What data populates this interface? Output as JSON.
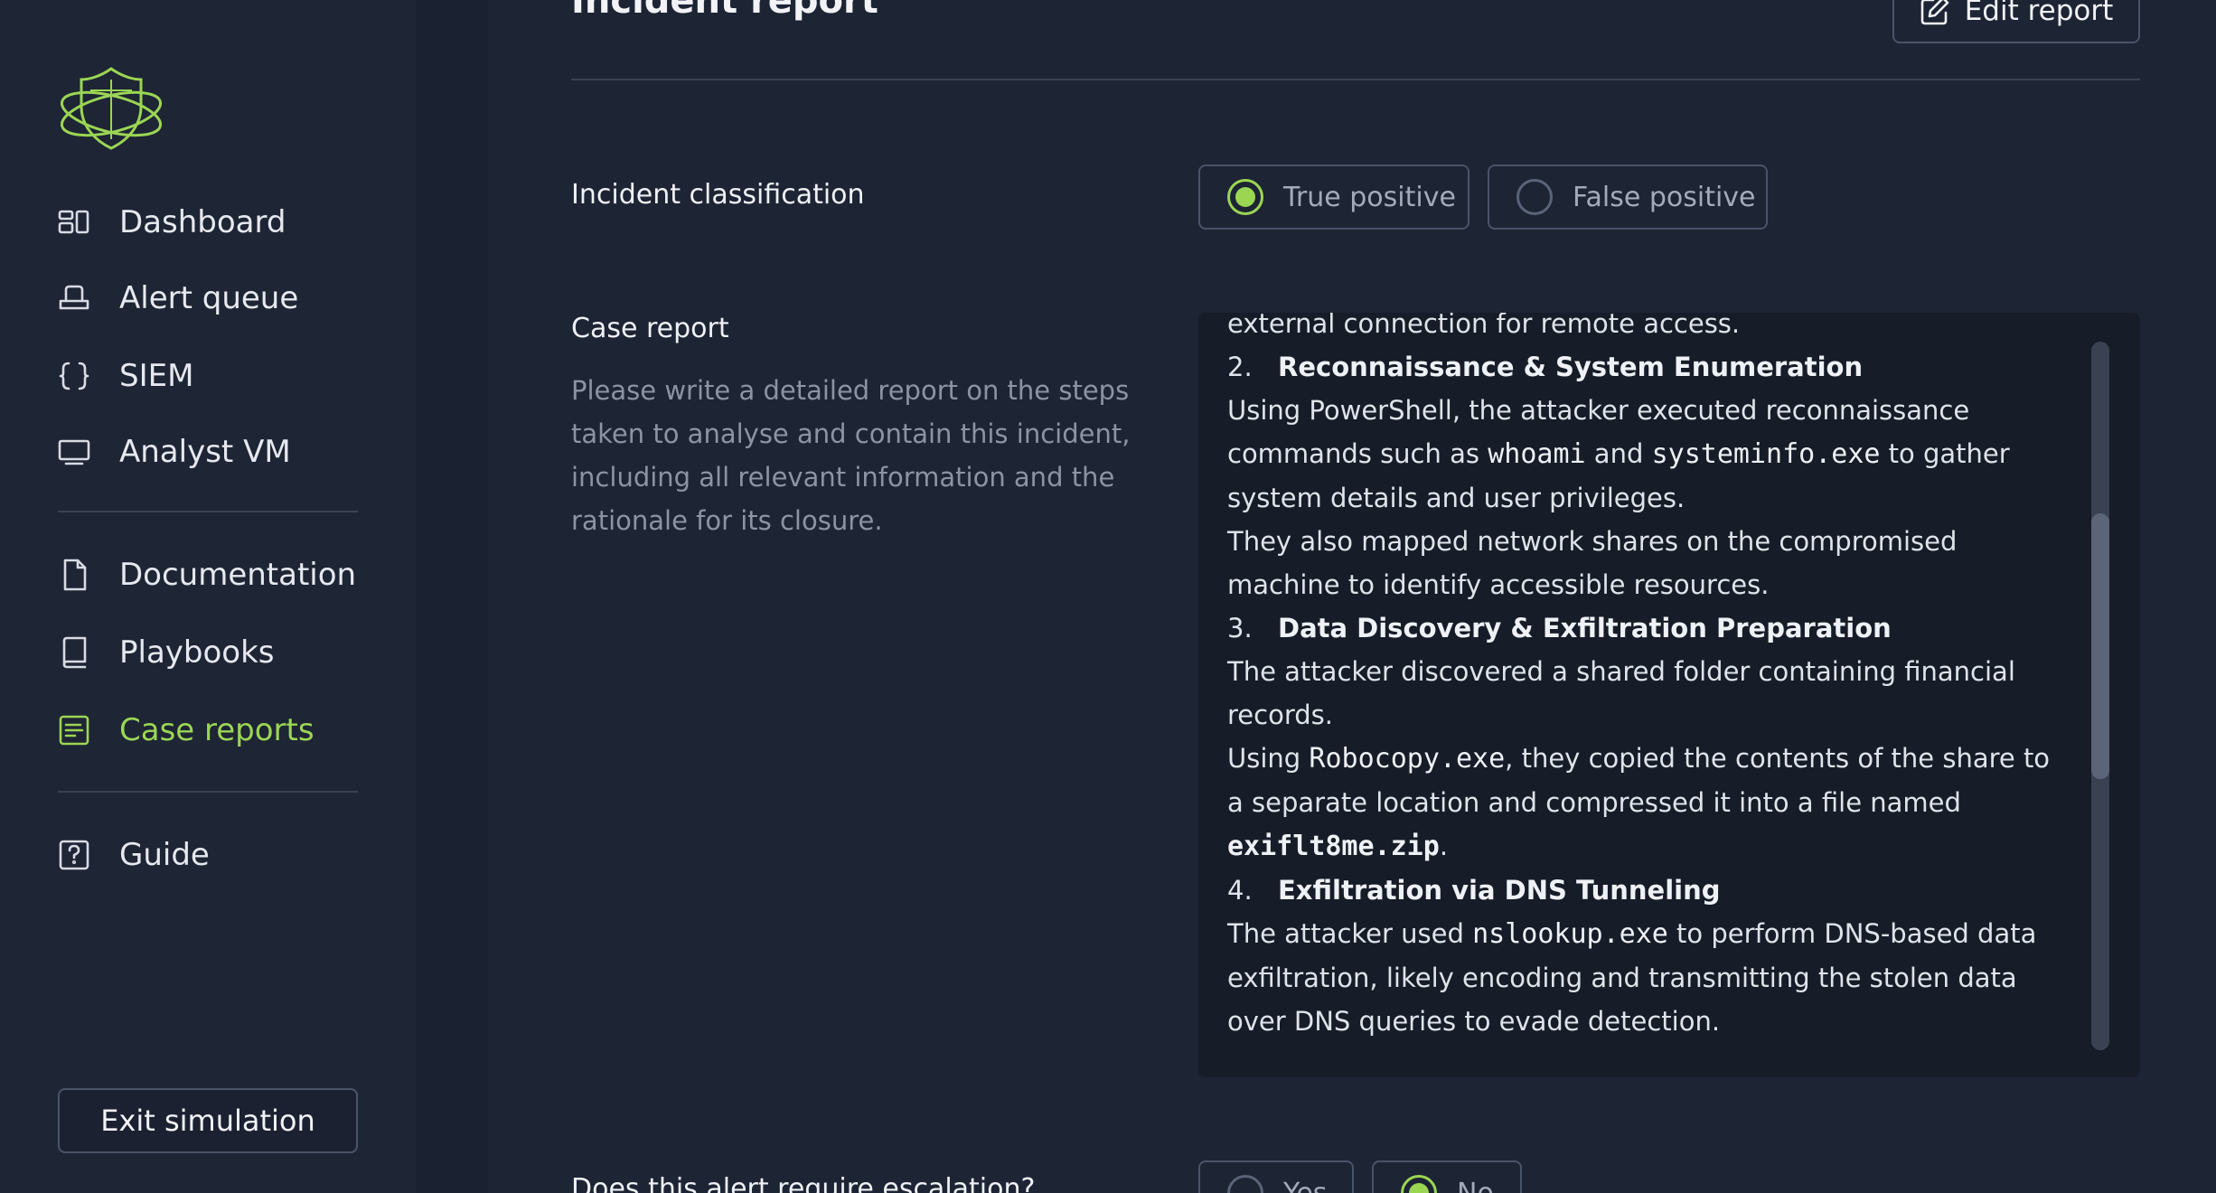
{
  "sidebar": {
    "nav": [
      {
        "label": "Dashboard",
        "icon": "dashboard-icon"
      },
      {
        "label": "Alert queue",
        "icon": "alert-queue-icon"
      },
      {
        "label": "SIEM",
        "icon": "braces-icon"
      },
      {
        "label": "Analyst VM",
        "icon": "monitor-icon"
      }
    ],
    "docs": [
      {
        "label": "Documentation",
        "icon": "file-icon"
      },
      {
        "label": "Playbooks",
        "icon": "book-icon"
      },
      {
        "label": "Case reports",
        "icon": "report-icon",
        "active": true
      }
    ],
    "guide": {
      "label": "Guide",
      "icon": "help-icon"
    },
    "exit_label": "Exit simulation"
  },
  "colors": {
    "accent": "#9bd653",
    "background": "#1d2434"
  },
  "main": {
    "title": "Incident report",
    "edit_label": "Edit report",
    "classification": {
      "label": "Incident classification",
      "options": [
        "True positive",
        "False positive"
      ],
      "selected": "True positive"
    },
    "case_report": {
      "label": "Case report",
      "hint": "Please write a detailed report on the steps taken to analyse and contain this incident, including all relevant information and the rationale for its closure.",
      "partial_line": "external connection for remote access.",
      "sections": [
        {
          "num": "2.",
          "heading": "Reconnaissance & System Enumeration",
          "p1_a": "Using PowerShell, the attacker executed reconnaissance commands such as ",
          "p1_code1": "whoami",
          "p1_b": " and ",
          "p1_code2": "systeminfo.exe",
          "p1_c": " to gather system details and user privileges.",
          "p2": "They also mapped network shares on the compromised machine to identify accessible resources."
        },
        {
          "num": "3.",
          "heading": "Data Discovery & Exfiltration Preparation",
          "p1": "The attacker discovered a shared folder containing financial records.",
          "p2_a": "Using ",
          "p2_code1": "Robocopy.exe",
          "p2_b": ", they copied the contents of the share to a separate location and compressed it into a file named ",
          "p2_code2": "exiflt8me.zip",
          "p2_c": "."
        },
        {
          "num": "4.",
          "heading": "Exfiltration via DNS Tunneling",
          "p1_a": "The attacker used ",
          "p1_code1": "nslookup.exe",
          "p1_b": " to perform DNS-based data exfiltration, likely encoding and transmitting the stolen data over DNS queries to evade detection."
        }
      ]
    },
    "escalation": {
      "label": "Does this alert require escalation?",
      "options": [
        "Yes",
        "No"
      ],
      "selected": "No"
    }
  }
}
